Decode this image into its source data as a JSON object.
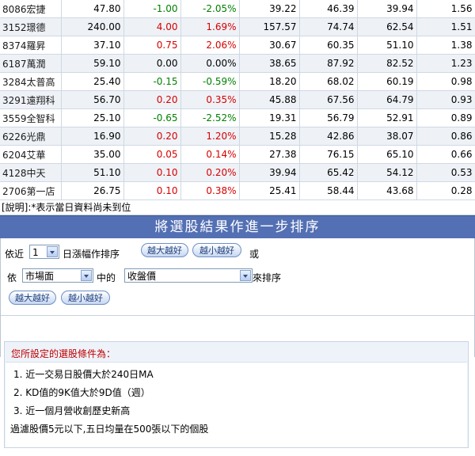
{
  "table": {
    "rows": [
      {
        "name": "8086宏捷",
        "price": "47.80",
        "change": "-1.00",
        "pct": "-2.05%",
        "dir": "neg",
        "c5": "39.22",
        "c6": "46.39",
        "c7": "39.94",
        "c8": "1.56"
      },
      {
        "name": "3152璟德",
        "price": "240.00",
        "change": "4.00",
        "pct": "1.69%",
        "dir": "pos",
        "c5": "157.57",
        "c6": "74.74",
        "c7": "62.54",
        "c8": "1.51"
      },
      {
        "name": "8374羅昇",
        "price": "37.10",
        "change": "0.75",
        "pct": "2.06%",
        "dir": "pos",
        "c5": "30.67",
        "c6": "60.35",
        "c7": "51.10",
        "c8": "1.38"
      },
      {
        "name": "6187萬潤",
        "price": "59.10",
        "change": "0.00",
        "pct": "0.00%",
        "dir": "zero",
        "c5": "38.65",
        "c6": "87.92",
        "c7": "82.52",
        "c8": "1.23"
      },
      {
        "name": "3284太普高",
        "price": "25.40",
        "change": "-0.15",
        "pct": "-0.59%",
        "dir": "neg",
        "c5": "18.20",
        "c6": "68.02",
        "c7": "60.19",
        "c8": "0.98"
      },
      {
        "name": "3291遠翔科",
        "price": "56.70",
        "change": "0.20",
        "pct": "0.35%",
        "dir": "pos",
        "c5": "45.88",
        "c6": "67.56",
        "c7": "64.79",
        "c8": "0.93"
      },
      {
        "name": "3559全智科",
        "price": "25.10",
        "change": "-0.65",
        "pct": "-2.52%",
        "dir": "neg",
        "c5": "19.31",
        "c6": "56.79",
        "c7": "52.91",
        "c8": "0.89"
      },
      {
        "name": "6226光鼎",
        "price": "16.90",
        "change": "0.20",
        "pct": "1.20%",
        "dir": "pos",
        "c5": "15.28",
        "c6": "42.86",
        "c7": "38.07",
        "c8": "0.86"
      },
      {
        "name": "6204艾華",
        "price": "35.00",
        "change": "0.05",
        "pct": "0.14%",
        "dir": "pos",
        "c5": "27.38",
        "c6": "76.15",
        "c7": "65.10",
        "c8": "0.66"
      },
      {
        "name": "4128中天",
        "price": "51.10",
        "change": "0.10",
        "pct": "0.20%",
        "dir": "pos",
        "c5": "39.94",
        "c6": "65.42",
        "c7": "54.12",
        "c8": "0.53"
      },
      {
        "name": "2706第一店",
        "price": "26.75",
        "change": "0.10",
        "pct": "0.38%",
        "dir": "pos",
        "c5": "25.41",
        "c6": "58.44",
        "c7": "43.68",
        "c8": "0.28"
      }
    ]
  },
  "note": "[說明]:*表示當日資料尚未到位",
  "banner": "將選股結果作進一步排序",
  "sort": {
    "line1_prefix": "依近",
    "days_value": "1",
    "line1_suffix": "日漲幅作排序",
    "bigger_better": "越大越好",
    "smaller_better": "越小越好",
    "or": "或",
    "by": "依",
    "market_value": "市場面",
    "in": "中的",
    "field_value": "收盤價",
    "sort_suffix": "來排序"
  },
  "criteria": {
    "title": "您所設定的選股條件為：",
    "lines": [
      "1. 近一交易日股價大於240日MA",
      "2. KD值的9K值大於9D值（週）",
      "3. 近一個月營收創歷史新高",
      "過濾股價5元以下,五日均量在500張以下的個股"
    ]
  }
}
